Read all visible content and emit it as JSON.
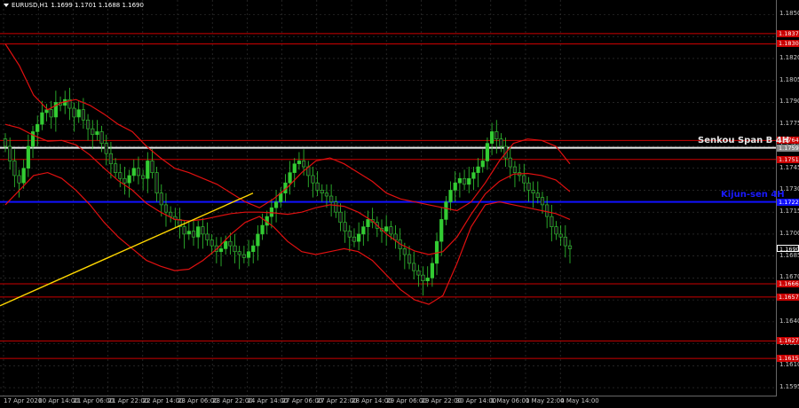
{
  "header": {
    "symbol": "EURUSD,H1",
    "ohlc": "1.1699 1.1701 1.1688 1.1690"
  },
  "colors": {
    "background": "#000000",
    "bull_candle": "#33cc33",
    "bear_candle": "#1a1a1a",
    "ichimoku": "#e01010",
    "kijun": "#1010ff",
    "senkou": "#e8e8e8",
    "level_lines": "#cc0000",
    "trendline": "#ffd700",
    "grid": "#3a3a3a"
  },
  "price_axis": {
    "ticks": [
      "1.1850",
      "1.1835",
      "1.1820",
      "1.1805",
      "1.1790",
      "1.1775",
      "1.1760",
      "1.1745",
      "1.1730",
      "1.1715",
      "1.1700",
      "1.1685",
      "1.1670",
      "1.1655",
      "1.1640",
      "1.1625",
      "1.1610",
      "1.1595"
    ]
  },
  "time_axis": {
    "ticks": [
      "17 Apr 2026",
      "20 Apr 14:00",
      "21 Apr 06:00",
      "21 Apr 22:00",
      "22 Apr 14:00",
      "23 Apr 06:00",
      "23 Apr 22:00",
      "24 Apr 14:00",
      "27 Apr 06:00",
      "27 Apr 22:00",
      "28 Apr 14:00",
      "29 Apr 06:00",
      "29 Apr 22:00",
      "30 Apr 14:00",
      "1 May 06:00",
      "1 May 22:00",
      "4 May 14:00"
    ]
  },
  "price_tags": [
    {
      "label": "1.1837",
      "price": 1.1837,
      "color": "#cc0000"
    },
    {
      "label": "1.1830",
      "price": 1.183,
      "color": "#cc0000"
    },
    {
      "label": "1.1764",
      "price": 1.1764,
      "color": "#cc0000"
    },
    {
      "label": "1.1759",
      "price": 1.1759,
      "color": "#888888"
    },
    {
      "label": "1.1751",
      "price": 1.1751,
      "color": "#cc0000"
    },
    {
      "label": "1.1722",
      "price": 1.1722,
      "color": "#1010ff"
    },
    {
      "label": "1.1690",
      "price": 1.169,
      "color": "#000000"
    },
    {
      "label": "1.1666",
      "price": 1.1666,
      "color": "#cc0000"
    },
    {
      "label": "1.1657",
      "price": 1.1657,
      "color": "#cc0000"
    },
    {
      "label": "1.1627",
      "price": 1.1627,
      "color": "#cc0000"
    },
    {
      "label": "1.1615",
      "price": 1.1615,
      "color": "#cc0000"
    }
  ],
  "levels": {
    "senkou": {
      "label": "Senkou Span B 4H",
      "price": 1.1759
    },
    "kijun": {
      "label": "Kijun-sen 4H",
      "price": 1.1722
    }
  },
  "chart_data": {
    "type": "candlestick",
    "symbol": "EURUSD",
    "timeframe": "H1",
    "ylim": [
      1.1589,
      1.186
    ],
    "last_price": 1.169,
    "horizontal_levels": [
      1.1837,
      1.183,
      1.1764,
      1.1751,
      1.1666,
      1.1657,
      1.1627,
      1.1615
    ],
    "senkou_span_b_4h": 1.1759,
    "kijun_sen_4h": 1.1722,
    "trendline": {
      "from": {
        "x": "17 Apr 2026",
        "y": 1.1651
      },
      "to": {
        "x": "24 Apr 14:00",
        "y": 1.1728
      }
    },
    "close_path": [
      1.176,
      1.175,
      1.174,
      1.1735,
      1.1745,
      1.176,
      1.177,
      1.1775,
      1.1783,
      1.1785,
      1.178,
      1.179,
      1.1788,
      1.1792,
      1.1786,
      1.178,
      1.1785,
      1.1778,
      1.1772,
      1.1768,
      1.177,
      1.1762,
      1.1755,
      1.1748,
      1.1742,
      1.1738,
      1.1735,
      1.174,
      1.1745,
      1.174,
      1.1738,
      1.175,
      1.1742,
      1.1728,
      1.172,
      1.1715,
      1.1712,
      1.171,
      1.1705,
      1.17,
      1.1702,
      1.1698,
      1.1705,
      1.17,
      1.1696,
      1.1692,
      1.1688,
      1.169,
      1.1695,
      1.1692,
      1.1688,
      1.1686,
      1.1684,
      1.1688,
      1.1692,
      1.17,
      1.1706,
      1.1712,
      1.1718,
      1.1722,
      1.1728,
      1.1735,
      1.1742,
      1.1748,
      1.175,
      1.1746,
      1.174,
      1.1735,
      1.173,
      1.1728,
      1.1726,
      1.1722,
      1.1715,
      1.1708,
      1.1702,
      1.1698,
      1.1695,
      1.17,
      1.1705,
      1.171,
      1.1708,
      1.1704,
      1.1702,
      1.1705,
      1.17,
      1.1696,
      1.169,
      1.1686,
      1.168,
      1.1675,
      1.1672,
      1.1668,
      1.167,
      1.168,
      1.1695,
      1.171,
      1.1722,
      1.173,
      1.1735,
      1.1738,
      1.1734,
      1.1738,
      1.1742,
      1.1746,
      1.175,
      1.1762,
      1.177,
      1.1765,
      1.176,
      1.1752,
      1.1746,
      1.1742,
      1.174,
      1.1735,
      1.173,
      1.1728,
      1.1725,
      1.172,
      1.1712,
      1.1705,
      1.17,
      1.1698,
      1.1692,
      1.169
    ],
    "ichimoku_upper_path": [
      1.183,
      1.1815,
      1.1795,
      1.1785,
      1.179,
      1.1792,
      1.1788,
      1.1782,
      1.1775,
      1.177,
      1.176,
      1.1752,
      1.1745,
      1.1742,
      1.1738,
      1.1734,
      1.1728,
      1.1722,
      1.1718,
      1.1724,
      1.1732,
      1.1742,
      1.175,
      1.1752,
      1.1748,
      1.1742,
      1.1736,
      1.1728,
      1.1724,
      1.1722,
      1.172,
      1.1718,
      1.1716,
      1.1722,
      1.1735,
      1.175,
      1.1762,
      1.1765,
      1.1764,
      1.176,
      1.1748
    ],
    "ichimoku_lower_path": [
      1.172,
      1.173,
      1.174,
      1.1742,
      1.1738,
      1.173,
      1.172,
      1.1708,
      1.1698,
      1.169,
      1.1682,
      1.1678,
      1.1675,
      1.1676,
      1.1682,
      1.169,
      1.17,
      1.1708,
      1.1712,
      1.1705,
      1.1695,
      1.1688,
      1.1686,
      1.1688,
      1.169,
      1.1688,
      1.1682,
      1.1672,
      1.1662,
      1.1655,
      1.1652,
      1.1658,
      1.168,
      1.1705,
      1.172,
      1.1722,
      1.172,
      1.1718,
      1.1716,
      1.1714,
      1.171
    ]
  }
}
